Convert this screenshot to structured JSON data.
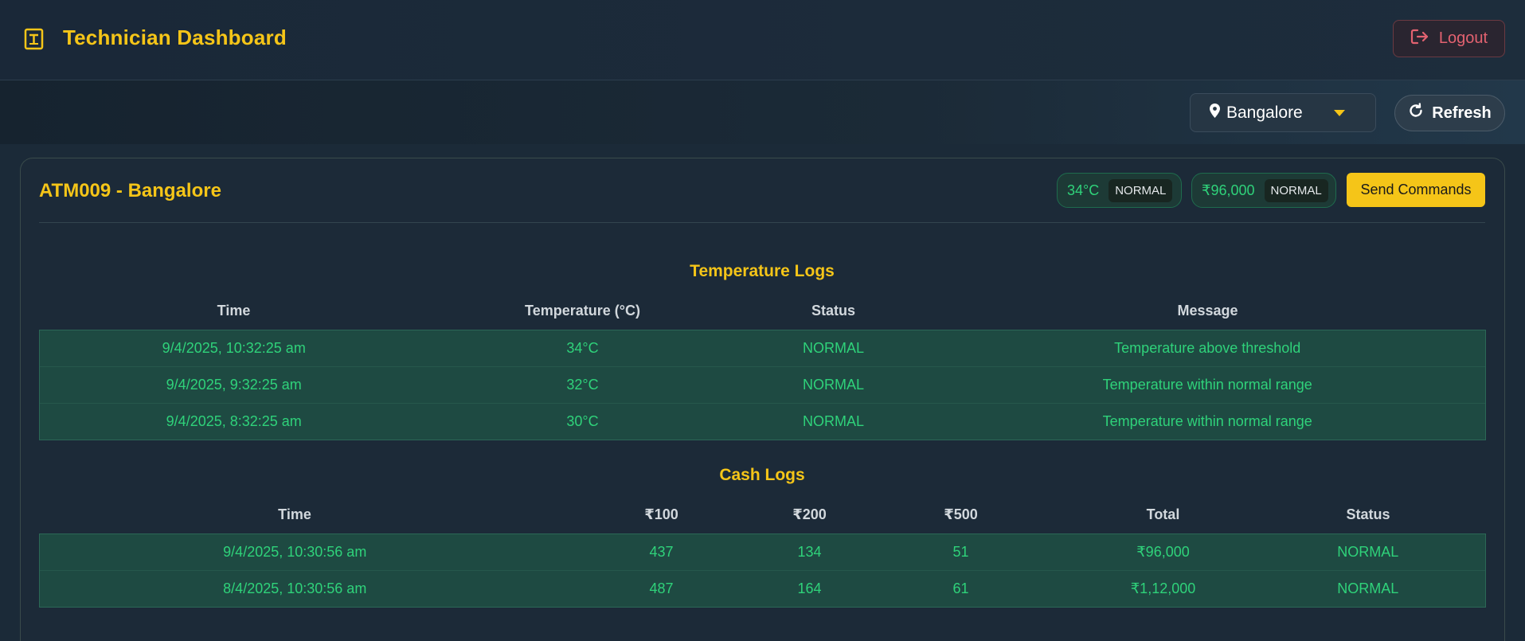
{
  "header": {
    "title": "Technician Dashboard",
    "logout_label": "Logout"
  },
  "toolbar": {
    "city": "Bangalore",
    "refresh_label": "Refresh"
  },
  "atm": {
    "title": "ATM009 - Bangalore",
    "temp_value": "34°C",
    "temp_status": "NORMAL",
    "cash_value": "₹96,000",
    "cash_status": "NORMAL",
    "send_commands_label": "Send Commands"
  },
  "temperature_logs": {
    "title": "Temperature Logs",
    "headers": [
      "Time",
      "Temperature (°C)",
      "Status",
      "Message"
    ],
    "rows": [
      [
        "9/4/2025, 10:32:25 am",
        "34°C",
        "NORMAL",
        "Temperature above threshold"
      ],
      [
        "9/4/2025, 9:32:25 am",
        "32°C",
        "NORMAL",
        "Temperature within normal range"
      ],
      [
        "9/4/2025, 8:32:25 am",
        "30°C",
        "NORMAL",
        "Temperature within normal range"
      ]
    ]
  },
  "cash_logs": {
    "title": "Cash Logs",
    "headers": [
      "Time",
      "₹100",
      "₹200",
      "₹500",
      "Total",
      "Status"
    ],
    "rows": [
      [
        "9/4/2025, 10:30:56 am",
        "437",
        "134",
        "51",
        "₹96,000",
        "NORMAL"
      ],
      [
        "8/4/2025, 10:30:56 am",
        "487",
        "164",
        "61",
        "₹1,12,000",
        "NORMAL"
      ]
    ]
  },
  "colors": {
    "accent": "#f5c518",
    "success": "#2fd27a",
    "danger": "#e36270",
    "background": "#1b2a38"
  }
}
